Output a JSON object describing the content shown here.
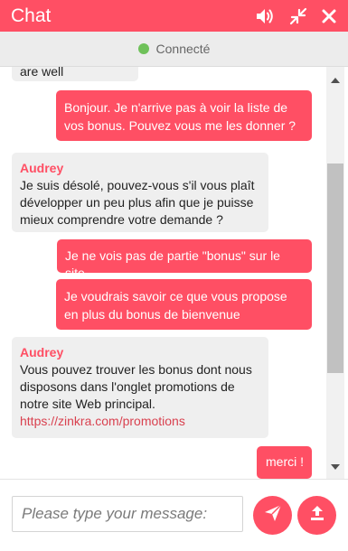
{
  "header": {
    "title": "Chat",
    "sound_icon": "speaker-icon",
    "minimize_icon": "compress-arrows-icon",
    "close_icon": "close-icon",
    "color": "#ff4f64"
  },
  "status": {
    "label": "Connecté",
    "dot_color": "#6fc15a"
  },
  "messages": [
    {
      "type": "agent",
      "text": "are well"
    },
    {
      "type": "user",
      "text": "Bonjour. Je n'arrive pas à voir la liste de vos bonus. Pouvez vous me les donner ?"
    },
    {
      "type": "agent",
      "sender": "Audrey",
      "text": "Je suis désolé, pouvez-vous s'il vous plaît développer un peu plus afin que je puisse mieux comprendre votre demande ?"
    },
    {
      "type": "user",
      "text": "Je ne vois pas de partie \"bonus\" sur le site"
    },
    {
      "type": "user",
      "text": "Je voudrais savoir ce que vous propose en plus du bonus de bienvenue"
    },
    {
      "type": "agent",
      "sender": "Audrey",
      "text": "Vous pouvez trouver les bonus dont nous disposons dans l'onglet promotions de notre site Web principal.",
      "link": "https://zinkra.com/promotions"
    },
    {
      "type": "user",
      "text": "merci !"
    }
  ],
  "composer": {
    "placeholder": "Please type your message:",
    "value": "",
    "send_icon": "paper-plane-icon",
    "upload_icon": "upload-icon"
  }
}
